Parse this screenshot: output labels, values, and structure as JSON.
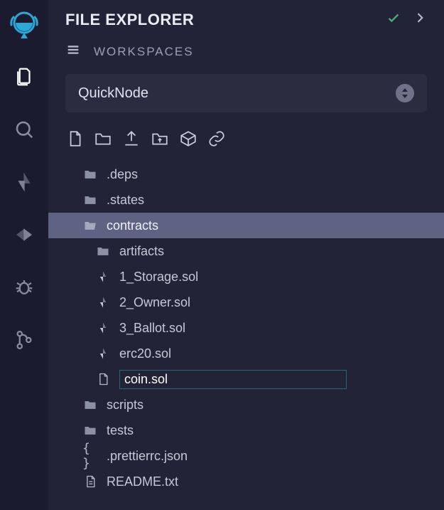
{
  "header": {
    "title": "FILE EXPLORER"
  },
  "workspaces": {
    "label": "WORKSPACES",
    "selected": "QuickNode"
  },
  "newFileInput": "coin.sol",
  "tree": {
    "deps": ".deps",
    "states": ".states",
    "contracts": "contracts",
    "artifacts": "artifacts",
    "storage": "1_Storage.sol",
    "owner": "2_Owner.sol",
    "ballot": "3_Ballot.sol",
    "erc20": "erc20.sol",
    "scripts": "scripts",
    "tests": "tests",
    "prettier": ".prettierrc.json",
    "readme": "README.txt"
  }
}
